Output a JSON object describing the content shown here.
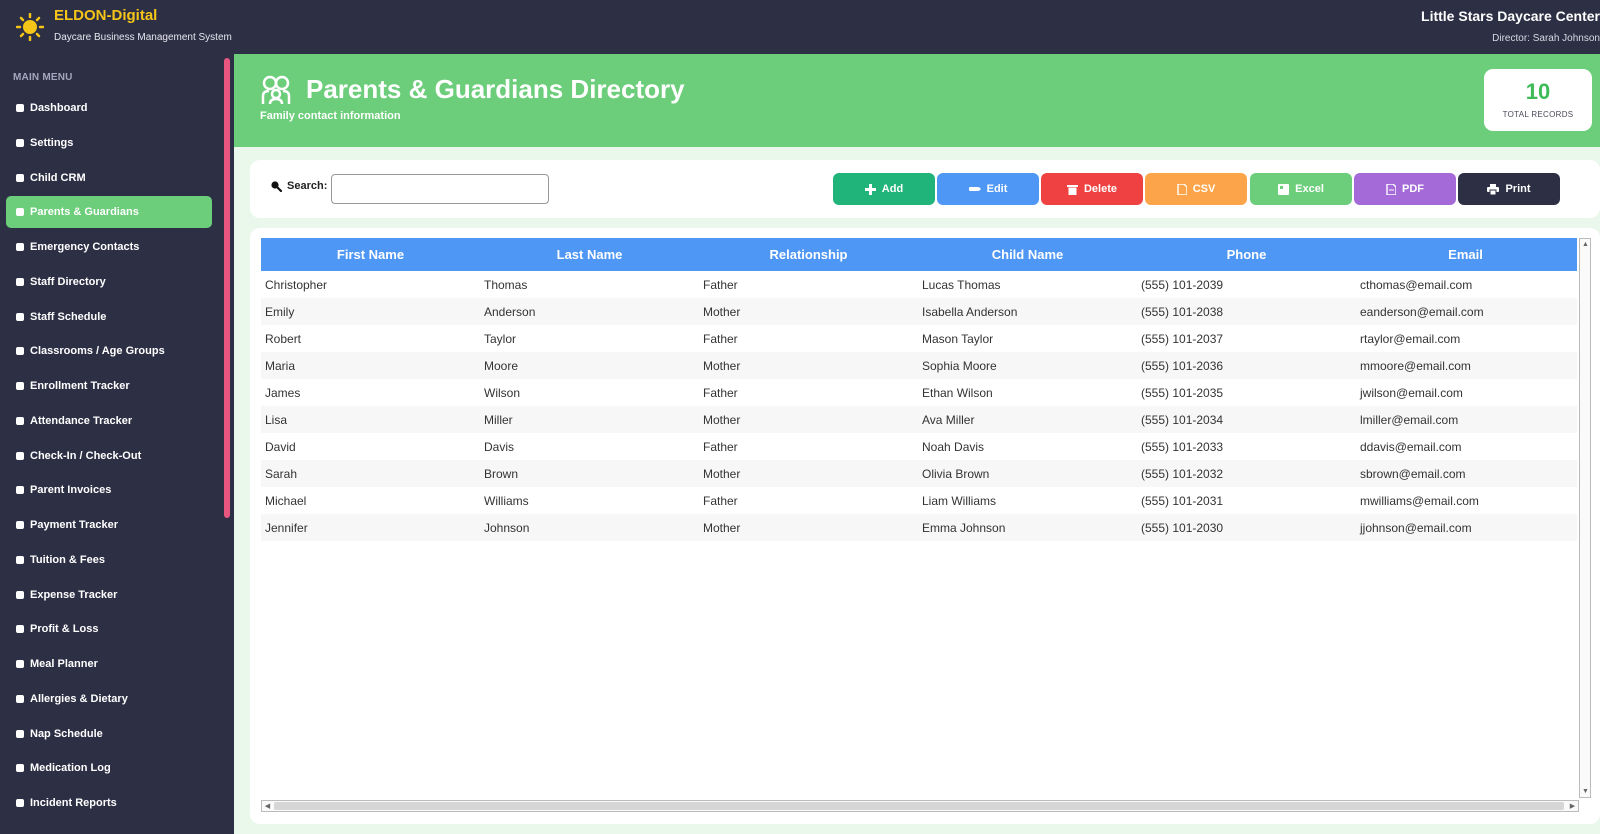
{
  "app": {
    "brand": "ELDON-Digital",
    "subtitle": "Daycare Business Management System",
    "center_name": "Little Stars Daycare Center",
    "director": "Director: Sarah Johnson"
  },
  "sidebar": {
    "title": "MAIN MENU",
    "items": [
      {
        "label": "Dashboard",
        "icon": "home-icon",
        "active": false
      },
      {
        "label": "Settings",
        "icon": "gear-icon",
        "active": false
      },
      {
        "label": "Child CRM",
        "icon": "child-icon",
        "active": false
      },
      {
        "label": "Parents & Guardians",
        "icon": "family-icon",
        "active": true
      },
      {
        "label": "Emergency Contacts",
        "icon": "phone-icon",
        "active": false
      },
      {
        "label": "Staff Directory",
        "icon": "people-icon",
        "active": false
      },
      {
        "label": "Staff Schedule",
        "icon": "calendar-icon",
        "active": false
      },
      {
        "label": "Classrooms / Age Groups",
        "icon": "school-icon",
        "active": false
      },
      {
        "label": "Enrollment Tracker",
        "icon": "clipboard-icon",
        "active": false
      },
      {
        "label": "Attendance Tracker",
        "icon": "checkbox-icon",
        "active": false
      },
      {
        "label": "Check-In / Check-Out",
        "icon": "door-icon",
        "active": false
      },
      {
        "label": "Parent Invoices",
        "icon": "invoice-icon",
        "active": false
      },
      {
        "label": "Payment Tracker",
        "icon": "card-icon",
        "active": false
      },
      {
        "label": "Tuition & Fees",
        "icon": "money-icon",
        "active": false
      },
      {
        "label": "Expense Tracker",
        "icon": "receipt-icon",
        "active": false
      },
      {
        "label": "Profit & Loss",
        "icon": "chart-icon",
        "active": false
      },
      {
        "label": "Meal Planner",
        "icon": "meal-icon",
        "active": false
      },
      {
        "label": "Allergies & Dietary",
        "icon": "warning-icon",
        "active": false
      },
      {
        "label": "Nap Schedule",
        "icon": "moon-icon",
        "active": false
      },
      {
        "label": "Medication Log",
        "icon": "pill-icon",
        "active": false
      },
      {
        "label": "Incident Reports",
        "icon": "report-icon",
        "active": false
      }
    ]
  },
  "header": {
    "title": "Parents & Guardians Directory",
    "subtitle": "Family contact information",
    "record_count": "10",
    "record_label": "TOTAL RECORDS"
  },
  "toolbar": {
    "search_label": "Search:",
    "search_value": "",
    "buttons": [
      {
        "label": "Add",
        "color": "#21b47a",
        "icon": "plus-icon"
      },
      {
        "label": "Edit",
        "color": "#4f97f5",
        "icon": "pencil-icon"
      },
      {
        "label": "Delete",
        "color": "#ef4141",
        "icon": "trash-icon"
      },
      {
        "label": "CSV",
        "color": "#fba449",
        "icon": "file-icon"
      },
      {
        "label": "Excel",
        "color": "#6ccd7a",
        "icon": "spreadsheet-icon"
      },
      {
        "label": "PDF",
        "color": "#a36ad8",
        "icon": "document-icon"
      },
      {
        "label": "Print",
        "color": "#2d2f45",
        "icon": "printer-icon"
      }
    ]
  },
  "table": {
    "columns": [
      "First Name",
      "Last Name",
      "Relationship",
      "Child Name",
      "Phone",
      "Email"
    ],
    "rows": [
      [
        "Christopher",
        "Thomas",
        "Father",
        "Lucas Thomas",
        "(555) 101-2039",
        "cthomas@email.com"
      ],
      [
        "Emily",
        "Anderson",
        "Mother",
        "Isabella Anderson",
        "(555) 101-2038",
        "eanderson@email.com"
      ],
      [
        "Robert",
        "Taylor",
        "Father",
        "Mason Taylor",
        "(555) 101-2037",
        "rtaylor@email.com"
      ],
      [
        "Maria",
        "Moore",
        "Mother",
        "Sophia Moore",
        "(555) 101-2036",
        "mmoore@email.com"
      ],
      [
        "James",
        "Wilson",
        "Father",
        "Ethan Wilson",
        "(555) 101-2035",
        "jwilson@email.com"
      ],
      [
        "Lisa",
        "Miller",
        "Mother",
        "Ava Miller",
        "(555) 101-2034",
        "lmiller@email.com"
      ],
      [
        "David",
        "Davis",
        "Father",
        "Noah Davis",
        "(555) 101-2033",
        "ddavis@email.com"
      ],
      [
        "Sarah",
        "Brown",
        "Mother",
        "Olivia Brown",
        "(555) 101-2032",
        "sbrown@email.com"
      ],
      [
        "Michael",
        "Williams",
        "Father",
        "Liam Williams",
        "(555) 101-2031",
        "mwilliams@email.com"
      ],
      [
        "Jennifer",
        "Johnson",
        "Mother",
        "Emma Johnson",
        "(555) 101-2030",
        "jjohnson@email.com"
      ]
    ]
  }
}
